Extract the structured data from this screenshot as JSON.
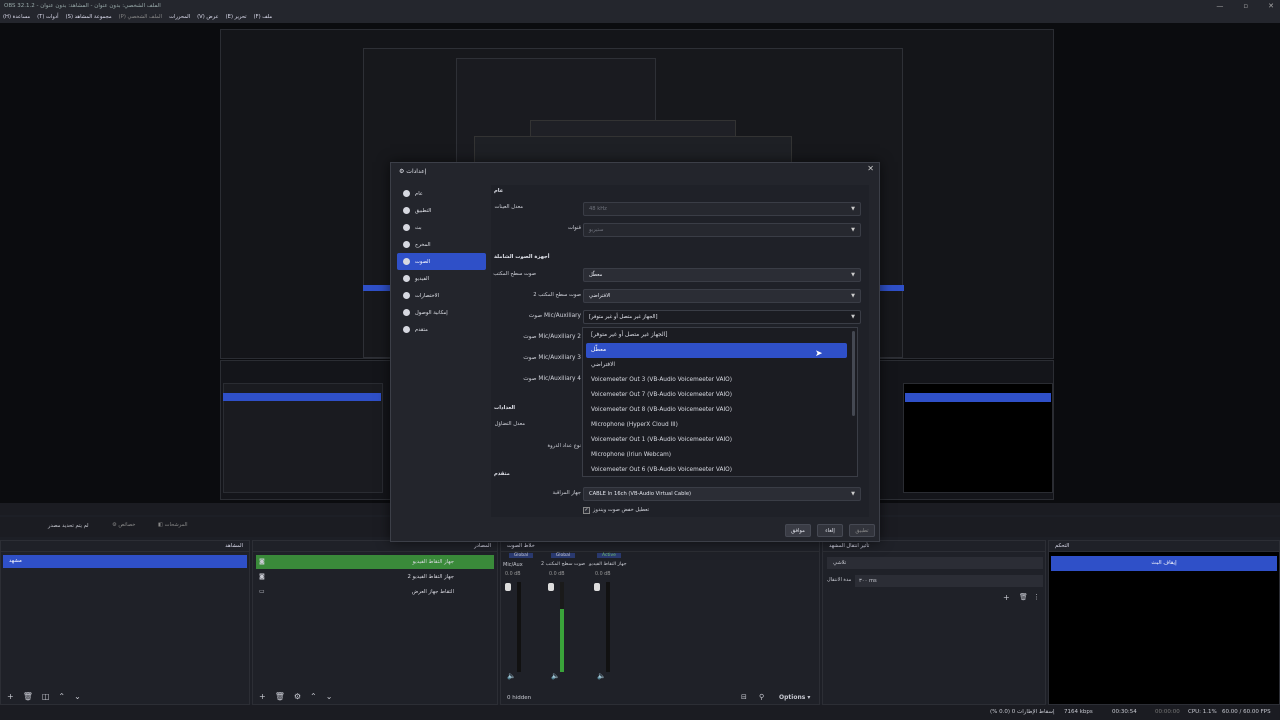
{
  "window": {
    "title": "OBS 32.1.2 - الملف الشخصي: بدون عنوان - المشاهد: بدون عنوان",
    "minimize": "—",
    "maximize": "▫",
    "close": "✕"
  },
  "menu": [
    "ملف (F)",
    "تحرير (E)",
    "عرض (V)",
    "المحررات",
    "الملف الشخصي (P)",
    "مجموعة المشاهد (S)",
    "أدوات (T)",
    "مساعدة (H)"
  ],
  "dialog": {
    "title": "إعدادات",
    "close": "✕",
    "sidebar": [
      {
        "label": "عام",
        "icon": "gear-icon"
      },
      {
        "label": "التطبيق",
        "icon": "brush-icon"
      },
      {
        "label": "بث",
        "icon": "broadcast-icon"
      },
      {
        "label": "المخرج",
        "icon": "output-icon"
      },
      {
        "label": "الصوت",
        "icon": "speaker-icon"
      },
      {
        "label": "الفيديو",
        "icon": "monitor-icon"
      },
      {
        "label": "الاختصارات",
        "icon": "keyboard-icon"
      },
      {
        "label": "إمكانية الوصول",
        "icon": "accessibility-icon"
      },
      {
        "label": "متقدم",
        "icon": "wrench-icon"
      }
    ],
    "active_index": 4,
    "sections": {
      "general": "عام",
      "global_devices": "أجهزة الصوت الشاملة",
      "meters": "العدادات",
      "advanced": "متقدم"
    },
    "fields": {
      "sample_rate_label": "معدل العينات",
      "sample_rate_value": "48 kHz",
      "channels_label": "قنوات",
      "channels_value": "ستيريو",
      "desktop_audio_label": "صوت سطح المكتب",
      "desktop_audio_value": "معطّل",
      "desktop_audio2_label": "صوت سطح المكتب 2",
      "desktop_audio2_value": "الافتراضي",
      "mic_label": "صوت Mic/Auxiliary",
      "mic_value": "[الجهاز غير متصل أو غير متوفر]",
      "mic2_label": "صوت Mic/Auxiliary 2",
      "mic3_label": "صوت Mic/Auxiliary 3",
      "mic4_label": "صوت Mic/Auxiliary 4",
      "decay_label": "معدل التضاؤل",
      "peak_label": "نوع عداد الذروة",
      "monitoring_label": "جهاز المراقبة",
      "monitoring_value": "CABLE In 16ch (VB-Audio Virtual Cable)",
      "ducking_label": "تعطيل خفض صوت ويندوز"
    },
    "dropdown_items": [
      "[الجهاز غير متصل أو غير متوفر]",
      "معطّل",
      "الافتراضي",
      "Voicemeeter Out 3 (VB-Audio Voicemeeter VAIO)",
      "Voicemeeter Out 7 (VB-Audio Voicemeeter VAIO)",
      "Voicemeeter Out 8 (VB-Audio Voicemeeter VAIO)",
      "Microphone (HyperX Cloud III)",
      "Voicemeeter Out 1 (VB-Audio Voicemeeter VAIO)",
      "Microphone (Iriun Webcam)",
      "Voicemeeter Out 6 (VB-Audio Voicemeeter VAIO)"
    ],
    "highlighted_index": 1,
    "buttons": {
      "ok": "موافق",
      "cancel": "إلغاء",
      "apply": "تطبيق"
    }
  },
  "controls": {
    "studio": "لم يتم تحديد مصدر",
    "properties": "خصائص",
    "filters": "المرشحات"
  },
  "docks": {
    "scenes": {
      "title": "المشاهد",
      "items": [
        "مشهد"
      ]
    },
    "sources": {
      "title": "المصادر",
      "items": [
        "جهاز التقاط الفيديو",
        "جهاز التقاط الفيديو 2",
        "التقاط جهاز العرض"
      ]
    },
    "mixer": {
      "title": "خلاط الصوت",
      "channels": [
        {
          "tag": "Global",
          "name": "Mic/Aux",
          "db": "0.0 dB"
        },
        {
          "tag": "Global",
          "name": "صوت سطح المكتب 2",
          "db": "0.0 dB"
        },
        {
          "tag": "Active",
          "name": "جهاز التقاط الفيديو",
          "db": "0.0 dB"
        }
      ],
      "hidden": "0 hidden",
      "options": "Options"
    },
    "transitions": {
      "title": "تأثير انتقال المشهد",
      "type": "تلاشي",
      "duration_label": "مدة الانتقال",
      "duration": "٣٠٠ ms"
    },
    "controls": {
      "title": "التحكم",
      "stop": "إيقاف البث"
    }
  },
  "status": {
    "dropped": "إسقاط الإطارات 0 (0.0 %)",
    "kbps": "7164 kbps",
    "live": "00:30:54",
    "rec": "00:00:00",
    "cpu": "CPU: 1.1%",
    "fps": "60.00 / 60.00 FPS"
  },
  "colors": {
    "accent": "#2f50c8",
    "green": "#3a8a3a"
  }
}
